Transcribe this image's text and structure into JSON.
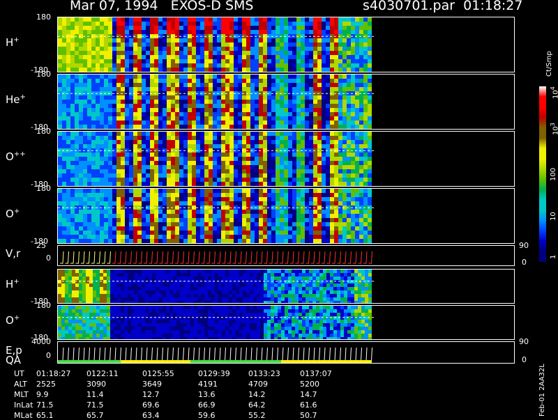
{
  "header": {
    "title": "Mar 07, 1994   EXOS-D SMS",
    "file": "s4030701.par  01:18:27"
  },
  "panels": [
    {
      "id": "h-plus-1",
      "label": "H",
      "sup": "+",
      "top_tick": "180",
      "bot_tick": "-180"
    },
    {
      "id": "he-plus",
      "label": "He",
      "sup": "+",
      "top_tick": "180",
      "bot_tick": "-180"
    },
    {
      "id": "o-plus-plus",
      "label": "O",
      "sup": "++",
      "top_tick": "180",
      "bot_tick": "-180"
    },
    {
      "id": "o-plus-1",
      "label": "O",
      "sup": "+",
      "top_tick": "180",
      "bot_tick": "-180"
    },
    {
      "id": "vr",
      "label": "V,r",
      "sup": "",
      "top_tick": "25",
      "bot_tick": "0",
      "right_top": "90",
      "right_bot": "0"
    },
    {
      "id": "h-plus-2",
      "label": "H",
      "sup": "+",
      "top_tick": "",
      "bot_tick": "-180"
    },
    {
      "id": "o-plus-2",
      "label": "O",
      "sup": "+",
      "top_tick": "180",
      "bot_tick": "-180"
    },
    {
      "id": "ep",
      "label": "E,p",
      "sup": "",
      "top_tick": "4000",
      "bot_tick": "0",
      "right_top": "90",
      "right_bot": "0",
      "label2": "QA"
    }
  ],
  "colorbar": {
    "unit": "Ct/Smp",
    "ticks": [
      "10^4",
      "10^3",
      "100",
      "10",
      "1"
    ]
  },
  "coords": {
    "row_labels": [
      "UT",
      "ALT",
      "MLT",
      "InLat",
      "MLat"
    ],
    "columns": [
      [
        "01:18:27",
        "2525",
        "9.9",
        "71.5",
        "65.1"
      ],
      [
        "0122:11",
        "3090",
        "11.4",
        "71.5",
        "65.7"
      ],
      [
        "0125:55",
        "3649",
        "12.7",
        "69.6",
        "63.4"
      ],
      [
        "0129:39",
        "4191",
        "13.6",
        "66.9",
        "59.6"
      ],
      [
        "0133:23",
        "4709",
        "14.2",
        "64.2",
        "55.2"
      ],
      [
        "0137:07",
        "5200",
        "14.7",
        "61.6",
        "50.7"
      ]
    ]
  },
  "footer": "Feb-01 2AA32L",
  "colors": {
    "bg": "#000000",
    "frame": "#ffffff",
    "low": "#000080",
    "high": "#ff0000"
  },
  "qa_colors": [
    "#44dd44",
    "#ffee00",
    "#44dd44",
    "#ffee00"
  ]
}
